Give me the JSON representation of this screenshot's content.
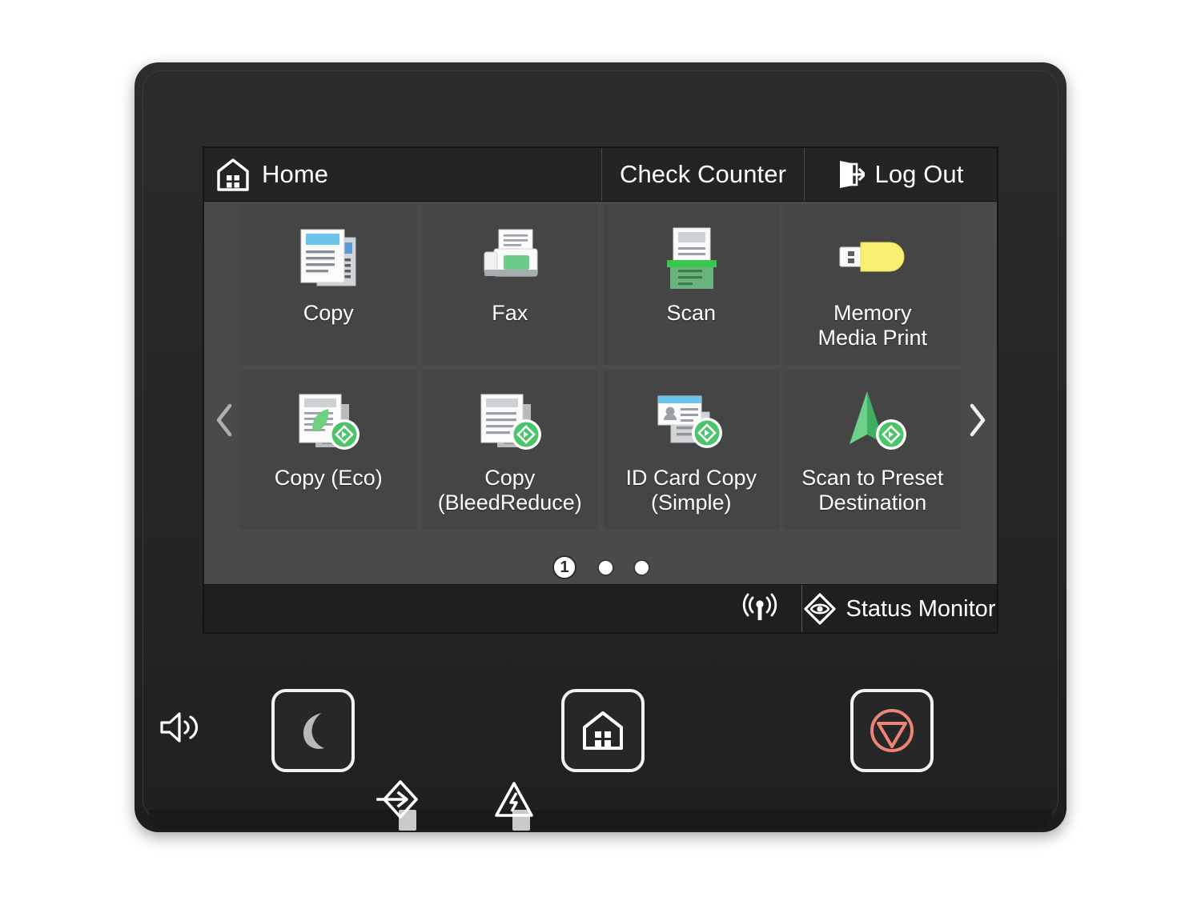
{
  "device": {
    "type": "multifunction-printer-control-panel",
    "bezel_color": "#262628",
    "screen_bg": "#4a4a4a"
  },
  "header": {
    "home_icon": "home-icon",
    "home_label": "Home",
    "check_counter_label": "Check Counter",
    "logout_icon": "logout-icon",
    "logout_label": "Log Out",
    "background": "#242424"
  },
  "grid": {
    "prev_icon": "chevron-left-icon",
    "next_icon": "chevron-right-icon",
    "tiles": [
      {
        "label": "Copy",
        "icon": "copy-documents-icon",
        "accent": "#61b8e8"
      },
      {
        "label": "Fax",
        "icon": "fax-machine-icon",
        "accent": "#5ec77f"
      },
      {
        "label": "Scan",
        "icon": "scanner-icon",
        "accent": "#3cc54a"
      },
      {
        "label": "Memory\nMedia Print",
        "icon": "usb-flash-drive-icon",
        "accent": "#f7eb6a"
      },
      {
        "label": "Copy (Eco)",
        "icon": "copy-eco-leaf-icon",
        "accent": "#4ec06a"
      },
      {
        "label": "Copy\n(BleedReduce)",
        "icon": "copy-bleed-reduce-icon",
        "accent": "#4ec06a"
      },
      {
        "label": "ID Card Copy\n(Simple)",
        "icon": "id-card-copy-icon",
        "accent": "#61b8e8"
      },
      {
        "label": "Scan to Preset\nDestination",
        "icon": "scan-preset-arrow-icon",
        "accent": "#5bc27c"
      }
    ]
  },
  "pager": {
    "current_page": "1",
    "total_pages": 3
  },
  "statusbar": {
    "wireless_icon": "wireless-signal-icon",
    "status_monitor_icon": "status-monitor-eye-icon",
    "status_monitor_label": "Status Monitor",
    "background": "#1f1f1f"
  },
  "hardware": {
    "buttons": [
      {
        "name": "sleep-button",
        "icon": "crescent-moon-icon",
        "color": "#b9b9b9"
      },
      {
        "name": "home-button",
        "icon": "home-icon",
        "color": "#ffffff"
      },
      {
        "name": "stop-button",
        "icon": "stop-circle-icon",
        "color": "#ec8573"
      }
    ],
    "indicators": [
      {
        "name": "volume-icon",
        "icon": "speaker-volume-icon"
      },
      {
        "name": "data-led-icon",
        "icon": "data-arrow-icon"
      },
      {
        "name": "error-led-icon",
        "icon": "warning-triangle-icon"
      }
    ]
  }
}
